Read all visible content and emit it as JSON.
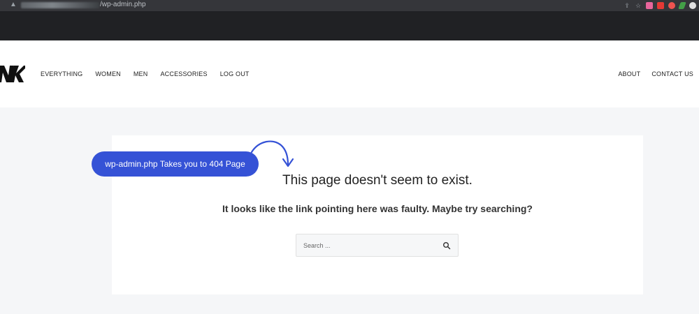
{
  "browser": {
    "url_visible": "/wp-admin.php",
    "warning_icon": "alert-triangle-icon"
  },
  "header": {
    "logo": "logo-icon",
    "nav_left": [
      "EVERYTHING",
      "WOMEN",
      "MEN",
      "ACCESSORIES",
      "LOG OUT"
    ],
    "nav_right": [
      "ABOUT",
      "CONTACT US"
    ]
  },
  "main": {
    "heading": "This page doesn't seem to exist.",
    "subheading": "It looks like the link pointing here was faulty. Maybe try searching?",
    "search": {
      "placeholder": "Search ...",
      "value": ""
    }
  },
  "annotation": {
    "text": "wp-admin.php Takes you to 404 Page",
    "color": "#3552d6"
  },
  "colors": {
    "page_bg": "#f5f6f8",
    "chrome_bg": "#202124",
    "accent": "#3552d6"
  }
}
